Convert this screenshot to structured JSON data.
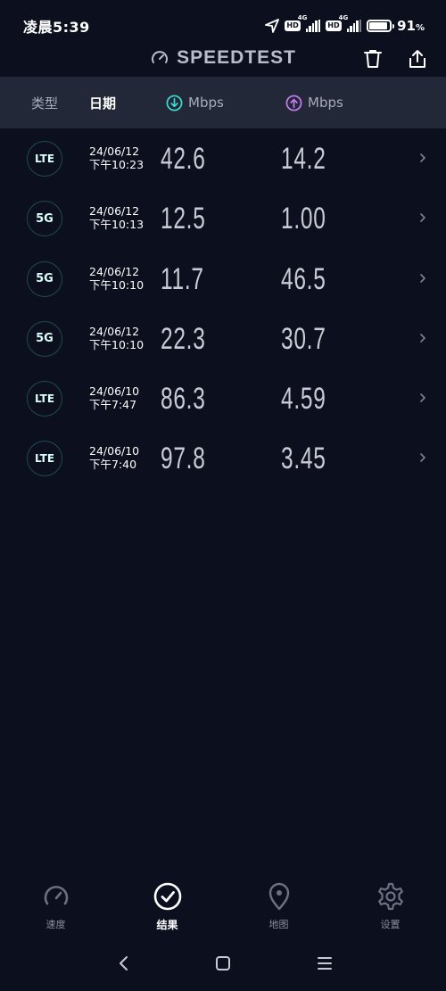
{
  "status_bar": {
    "time": "凌晨5:39",
    "hd1": "HD",
    "net1": "4G",
    "hd2": "HD",
    "net2": "4G",
    "battery_pct": "91",
    "battery_unit": "%",
    "battery_level": 0.91
  },
  "header": {
    "brand": "SPEEDTEST",
    "icons": {
      "brand": "speedometer-icon",
      "trash": "trash-icon",
      "share": "share-icon"
    }
  },
  "columns": {
    "type": "类型",
    "date": "日期",
    "download": "Mbps",
    "upload": "Mbps",
    "download_icon": "download-arrow-icon",
    "upload_icon": "upload-arrow-icon",
    "download_color": "#3ddcd0",
    "upload_color": "#c77cf2"
  },
  "results": [
    {
      "type": "LTE",
      "date": "24/06/12",
      "time": "下午10:23",
      "download": "42.6",
      "upload": "14.2"
    },
    {
      "type": "5G",
      "date": "24/06/12",
      "time": "下午10:13",
      "download": "12.5",
      "upload": "1.00"
    },
    {
      "type": "5G",
      "date": "24/06/12",
      "time": "下午10:10",
      "download": "11.7",
      "upload": "46.5"
    },
    {
      "type": "5G",
      "date": "24/06/12",
      "time": "下午10:10",
      "download": "22.3",
      "upload": "30.7"
    },
    {
      "type": "LTE",
      "date": "24/06/10",
      "time": "下午7:47",
      "download": "86.3",
      "upload": "4.59"
    },
    {
      "type": "LTE",
      "date": "24/06/10",
      "time": "下午7:40",
      "download": "97.8",
      "upload": "3.45"
    }
  ],
  "bottom_nav": [
    {
      "label": "速度",
      "icon": "speedometer-icon",
      "active": false
    },
    {
      "label": "结果",
      "icon": "check-circle-icon",
      "active": true
    },
    {
      "label": "地图",
      "icon": "map-pin-icon",
      "active": false
    },
    {
      "label": "设置",
      "icon": "gear-icon",
      "active": false
    }
  ],
  "system_nav": {
    "back": "back-icon",
    "home": "home-icon",
    "menu": "menu-icon"
  },
  "colors": {
    "background": "#0c0f1e",
    "header_bar": "#232839",
    "badge_ring": "#1f4a4f",
    "speed_text": "#c9cbd4"
  }
}
